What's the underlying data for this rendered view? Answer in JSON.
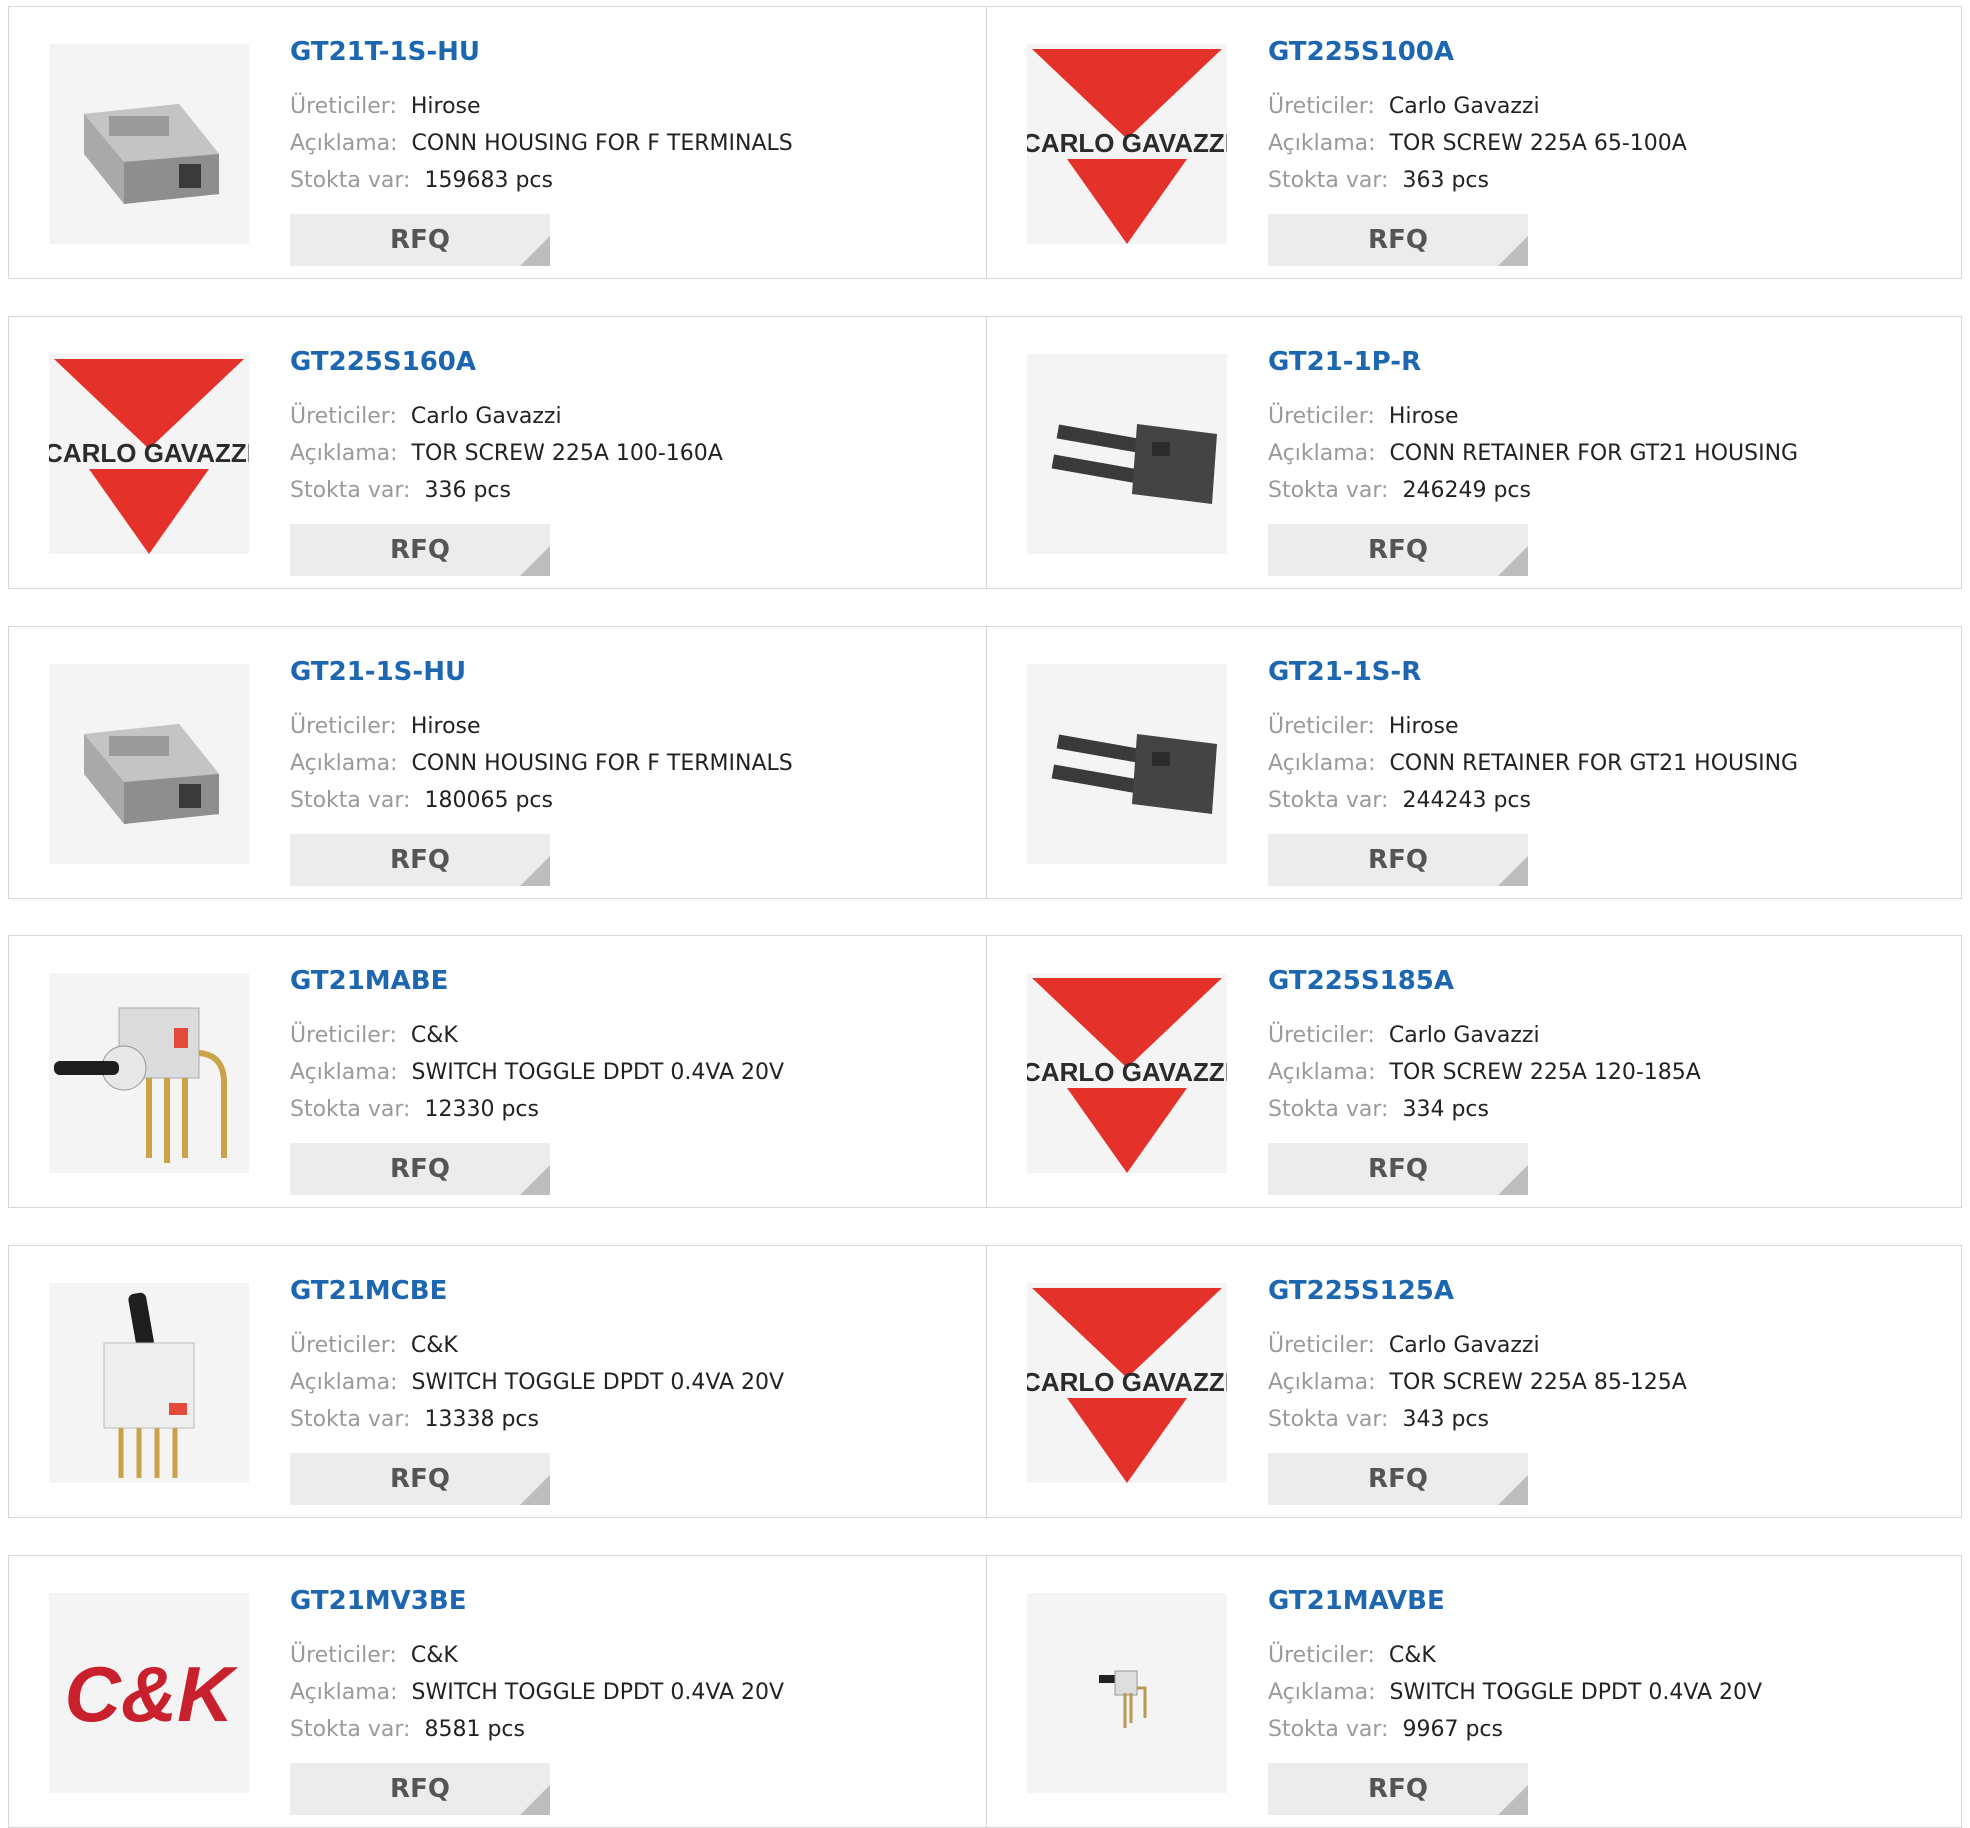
{
  "labels": {
    "manufacturer": "Üreticiler:",
    "description": "Açıklama:",
    "stock": "Stokta var:",
    "rfq": "RFQ"
  },
  "products": [
    {
      "part": "GT21T-1S-HU",
      "manufacturer": "Hirose",
      "description": "CONN HOUSING FOR F TERMINALS",
      "stock": "159683 pcs",
      "image": "connector-housing-icon"
    },
    {
      "part": "GT225S100A",
      "manufacturer": "Carlo Gavazzi",
      "description": "TOR SCREW 225A 65-100A",
      "stock": "363 pcs",
      "image": "carlo-gavazzi-logo",
      "logo_text": "CARLO GAVAZZI"
    },
    {
      "part": "GT225S160A",
      "manufacturer": "Carlo Gavazzi",
      "description": "TOR SCREW 225A 100-160A",
      "stock": "336 pcs",
      "image": "carlo-gavazzi-logo",
      "logo_text": "CARLO GAVAZZI"
    },
    {
      "part": "GT21-1P-R",
      "manufacturer": "Hirose",
      "description": "CONN RETAINER FOR GT21 HOUSING",
      "stock": "246249 pcs",
      "image": "retainer-icon"
    },
    {
      "part": "GT21-1S-HU",
      "manufacturer": "Hirose",
      "description": "CONN HOUSING FOR F TERMINALS",
      "stock": "180065 pcs",
      "image": "connector-housing-icon"
    },
    {
      "part": "GT21-1S-R",
      "manufacturer": "Hirose",
      "description": "CONN RETAINER FOR GT21 HOUSING",
      "stock": "244243 pcs",
      "image": "retainer-icon"
    },
    {
      "part": "GT21MABE",
      "manufacturer": "C&K",
      "description": "SWITCH TOGGLE DPDT 0.4VA 20V",
      "stock": "12330 pcs",
      "image": "toggle-switch-angled-icon"
    },
    {
      "part": "GT225S185A",
      "manufacturer": "Carlo Gavazzi",
      "description": "TOR SCREW 225A 120-185A",
      "stock": "334 pcs",
      "image": "carlo-gavazzi-logo",
      "logo_text": "CARLO GAVAZZI"
    },
    {
      "part": "GT21MCBE",
      "manufacturer": "C&K",
      "description": "SWITCH TOGGLE DPDT 0.4VA 20V",
      "stock": "13338 pcs",
      "image": "toggle-switch-vertical-icon"
    },
    {
      "part": "GT225S125A",
      "manufacturer": "Carlo Gavazzi",
      "description": "TOR SCREW 225A 85-125A",
      "stock": "343 pcs",
      "image": "carlo-gavazzi-logo",
      "logo_text": "CARLO GAVAZZI"
    },
    {
      "part": "GT21MV3BE",
      "manufacturer": "C&K",
      "description": "SWITCH TOGGLE DPDT 0.4VA 20V",
      "stock": "8581 pcs",
      "image": "ck-logo",
      "logo_text": "C&K"
    },
    {
      "part": "GT21MAVBE",
      "manufacturer": "C&K",
      "description": "SWITCH TOGGLE DPDT 0.4VA 20V",
      "stock": "9967 pcs",
      "image": "small-toggle-switch-icon"
    }
  ]
}
